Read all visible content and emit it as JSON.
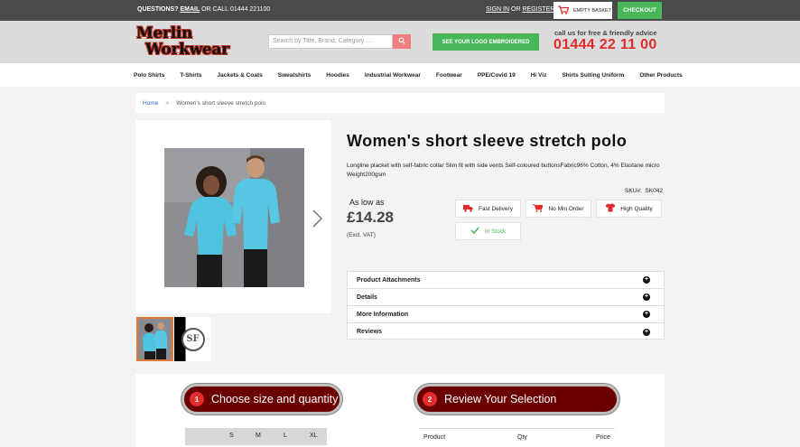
{
  "topbar": {
    "questions": "QUESTIONS?",
    "email": "EMAIL",
    "or_call": "OR CALL",
    "phone": "01444 221100",
    "sign_in": "SIGN IN",
    "or": "OR",
    "register": "REGISTER",
    "basket": "EMPTY BASKET",
    "checkout": "CHECKOUT"
  },
  "header": {
    "logo_line1": "Merlin",
    "logo_line2": "Workwear",
    "search_placeholder": "Search by Title, Brand, Category ...",
    "logo_button": "SEE YOUR LOGO EMBROIDERED",
    "call_text": "call us for free & friendly advice",
    "phone": "01444 22 11 00"
  },
  "nav": [
    "Polo Shirts",
    "T-Shirts",
    "Jackets & Coats",
    "Sweatshirts",
    "Hoodies",
    "Industrial Workwear",
    "Footwear",
    "PPE/Covid 19",
    "Hi Viz",
    "Shirts Suiting Uniform",
    "Other Products"
  ],
  "breadcrumb": {
    "home": "Home",
    "sep": ">",
    "current": "Women's short sleeve stretch polo"
  },
  "product": {
    "title": "Women's short sleeve stretch polo",
    "description": "Longline placket with self-fabric collar Slim fit with side vents Self-coloured buttonsFabric96% Cotton, 4% Elastane micro Weight200gsm",
    "sku_label": "SKU#:",
    "sku": "SK042",
    "as_low_as": "As low as",
    "price": "£14.28",
    "vat": "(Excl. VAT)",
    "thumb2_text": "SF"
  },
  "badges": [
    "Fast Delivery",
    "No Min Order",
    "High Quality",
    "In Stock"
  ],
  "accordion": [
    "Product Attachments",
    "Details",
    "More Information",
    "Reviews"
  ],
  "steps": [
    {
      "num": "1",
      "label": "Choose size and quantity"
    },
    {
      "num": "2",
      "label": "Review Your Selection"
    }
  ],
  "sizes": [
    "S",
    "M",
    "L",
    "XL"
  ],
  "review_headers": [
    "Product",
    "Qty",
    "Price"
  ],
  "colors": {
    "accent_red": "#e32b2b",
    "green": "#48b75a",
    "dark_red": "#6a0000",
    "polo": "#4fc3e0"
  }
}
